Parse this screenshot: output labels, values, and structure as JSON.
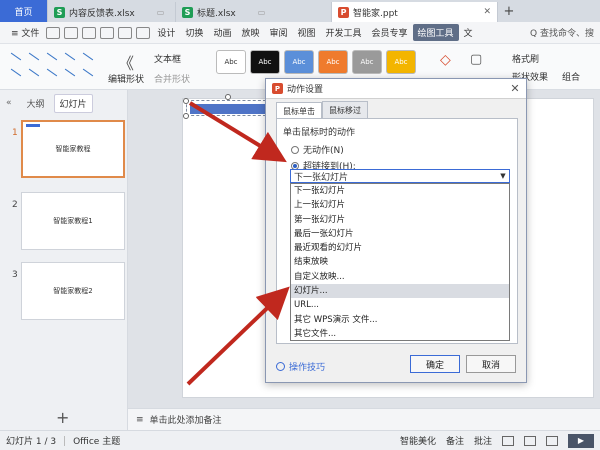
{
  "tabs": [
    {
      "label": "首页",
      "type": "home"
    },
    {
      "label": "内容反馈表.xlsx",
      "badge": "S",
      "badge_color": "#1f9d55"
    },
    {
      "label": "标题.xlsx",
      "badge": "S",
      "badge_color": "#1f9d55"
    },
    {
      "label": "智能家.ppt",
      "badge": "P",
      "badge_color": "#d84c2f",
      "active": true
    }
  ],
  "menubar": {
    "file": "≡ 文件",
    "items": [
      "设计",
      "切换",
      "动画",
      "放映",
      "审阅",
      "视图",
      "开发工具",
      "会员专享"
    ],
    "highlight": "绘图工具",
    "tail": "文",
    "search": "Q 查找命令、搜"
  },
  "ribbon": {
    "edit_shape": "编辑形状",
    "textbox": "文本框",
    "merge_shape": "合并形状",
    "format_painter": "格式刷",
    "style_swatch": "Abc",
    "group": "组合",
    "shape_effect": "形状效果",
    "swatches": [
      {
        "bg": "#ffffff",
        "fg": "#333333"
      },
      {
        "bg": "#111111",
        "fg": "#ffffff"
      },
      {
        "bg": "#5b8fd9",
        "fg": "#ffffff"
      },
      {
        "bg": "#ef7b2d",
        "fg": "#ffffff"
      },
      {
        "bg": "#9a9a9a",
        "fg": "#ffffff"
      },
      {
        "bg": "#f3b500",
        "fg": "#ffffff"
      }
    ]
  },
  "leftpanel": {
    "tab_outline": "大纲",
    "tab_slides": "幻灯片",
    "slides": [
      {
        "num": "1",
        "title": "智能家教程"
      },
      {
        "num": "2",
        "title": "智能家教程1"
      },
      {
        "num": "3",
        "title": "智能家教程2"
      }
    ],
    "add": "+"
  },
  "notes": {
    "placeholder": "单击此处添加备注"
  },
  "status": {
    "slide": "幻灯片 1 / 3",
    "theme": "Office 主题",
    "beautify": "智能美化",
    "notes": "备注",
    "comments": "批注"
  },
  "dialog": {
    "title": "动作设置",
    "tab_click": "鼠标单击",
    "tab_hover": "鼠标移过",
    "section": "单击鼠标时的动作",
    "opt_none": "无动作(N)",
    "opt_link": "超链接到(H):",
    "selected": "下一张幻灯片",
    "options": [
      "下一张幻灯片",
      "上一张幻灯片",
      "第一张幻灯片",
      "最后一张幻灯片",
      "最近观看的幻灯片",
      "结束放映",
      "自定义放映...",
      "幻灯片...",
      "URL...",
      "其它 WPS演示 文件...",
      "其它文件..."
    ],
    "hovered_index": 7,
    "tips": "操作技巧",
    "ok": "确定",
    "cancel": "取消"
  }
}
